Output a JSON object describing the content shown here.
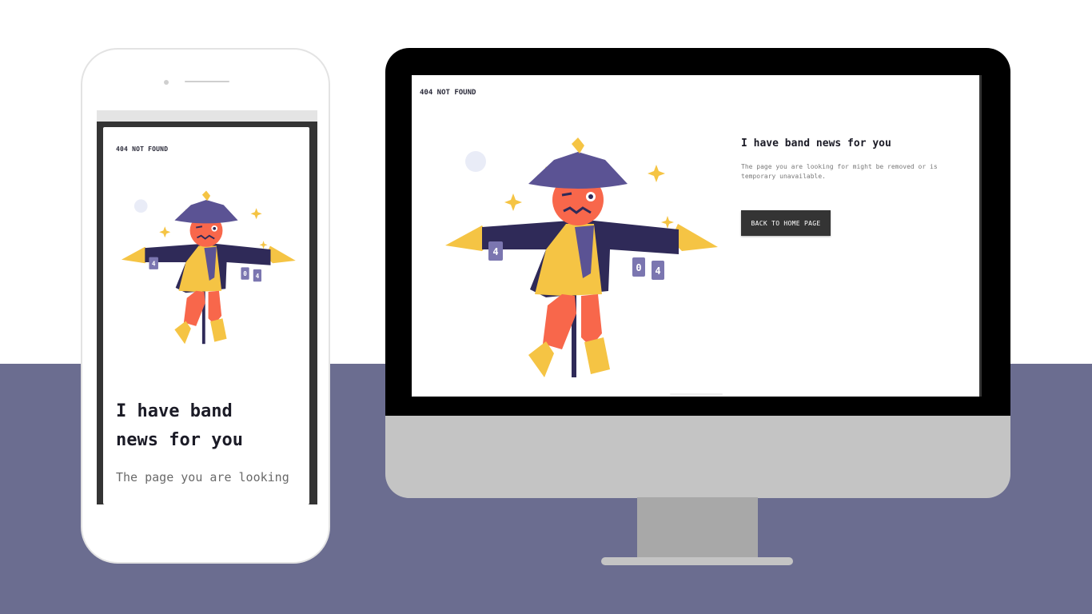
{
  "brand": "404 NOT FOUND",
  "heading": "I have band news for you",
  "heading_mobile_lines": [
    "I have band",
    "news for you"
  ],
  "message": "The page you are looking for might be removed or is temporary unavailable.",
  "message_mobile_visible": "The page you are looking",
  "button_label": "BACK TO HOME PAGE",
  "can_labels": [
    "4",
    "0",
    "4"
  ],
  "illustration": "scarecrow",
  "colors": {
    "background": "#ffffff",
    "floor": "#6b6d90",
    "hat": "#5b5394",
    "coat": "#2f2a58",
    "face": "#f8674b",
    "straw": "#f5c444",
    "can": "#7b76b0",
    "button_bg": "#343434",
    "device_bezel": "#000000",
    "device_body": "#c4c4c4"
  }
}
